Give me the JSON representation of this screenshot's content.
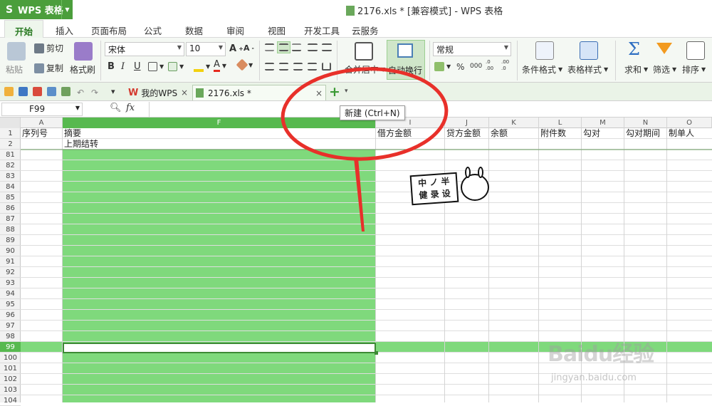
{
  "app": {
    "name": "WPS 表格",
    "logo": "S"
  },
  "window": {
    "file_icon": "spreadsheet-file-icon",
    "title": "2176.xls * [兼容模式] - WPS 表格"
  },
  "ribbon_tabs": [
    "开始",
    "插入",
    "页面布局",
    "公式",
    "数据",
    "审阅",
    "视图",
    "开发工具",
    "云服务"
  ],
  "ribbon": {
    "paste": "粘贴",
    "cut": "剪切",
    "copy": "复制",
    "format_painter": "格式刷",
    "font_name": "宋体",
    "font_size": "10",
    "bold": "B",
    "italic": "I",
    "underline": "U",
    "merge_center": "合并居中",
    "wrap_text": "自动换行",
    "number_format": "常规",
    "percent": "%",
    "comma": "000",
    "inc_decimal": ".0 .00",
    "dec_decimal": ".00 .0",
    "conditional_format": "条件格式",
    "table_style": "表格样式",
    "sum": "求和",
    "filter": "筛选",
    "sort": "排序"
  },
  "doc_tabs": [
    {
      "label": "我的WPS",
      "active": false
    },
    {
      "label": "2176.xls *",
      "active": true
    }
  ],
  "new_tab_tooltip": "新建 (Ctrl+N)",
  "formula_bar": {
    "name_box": "F99",
    "fx": "fx",
    "value": ""
  },
  "columns": [
    "A",
    "F",
    "I",
    "J",
    "K",
    "L",
    "M",
    "N",
    "O"
  ],
  "rows": [
    "1",
    "2",
    "81",
    "82",
    "83",
    "84",
    "85",
    "86",
    "87",
    "88",
    "89",
    "90",
    "91",
    "92",
    "93",
    "94",
    "95",
    "96",
    "97",
    "98",
    "99",
    "100",
    "101",
    "102",
    "103",
    "104"
  ],
  "header_row": {
    "A": "序列号",
    "F": "摘要",
    "I": "借方金额",
    "J": "贷方金额",
    "K": "余额",
    "L": "附件数",
    "M": "勾对",
    "N": "勾对期间",
    "O": "制单人"
  },
  "row2": {
    "F": "上期结转"
  },
  "sticker": {
    "lines": [
      "中 ノ 半",
      "健 录 设"
    ]
  },
  "watermark": {
    "brand": "Baidu经验",
    "url": "jingyan.baidu.com"
  },
  "colors": {
    "accent": "#4b9e3c",
    "selection": "#7fd97c",
    "annotation": "#e8302a"
  }
}
